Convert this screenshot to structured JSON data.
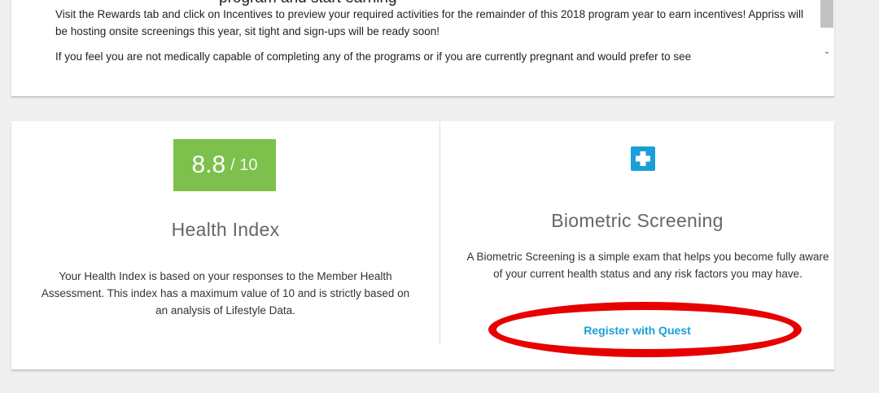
{
  "message": {
    "heading_partial": "program and start earning",
    "paragraphs": [
      "Visit the Rewards tab and click on Incentives to preview your required activities for the remainder of this 2018 program year to earn incentives! Appriss will be hosting onsite screenings this year, sit tight and sign-ups will be ready soon!",
      "If you feel you are not medically capable of completing any of the programs or if you are currently pregnant and would prefer to see"
    ]
  },
  "health_index": {
    "score": "8.8",
    "score_max": "/ 10",
    "title": "Health Index",
    "description": "Your Health Index is based on your responses to the Member Health Assessment. This index has a maximum value of 10 and is strictly based on an analysis of Lifestyle Data."
  },
  "biometric": {
    "icon": "plus-icon",
    "title": "Biometric Screening",
    "description": "A Biometric Screening is a simple exam that helps you become fully aware of your current health status and any risk factors you may have.",
    "link_label": "Register with Quest"
  },
  "colors": {
    "score_bg": "#7dc04c",
    "accent_blue": "#1a9fd8",
    "annotation_red": "#e60000"
  }
}
